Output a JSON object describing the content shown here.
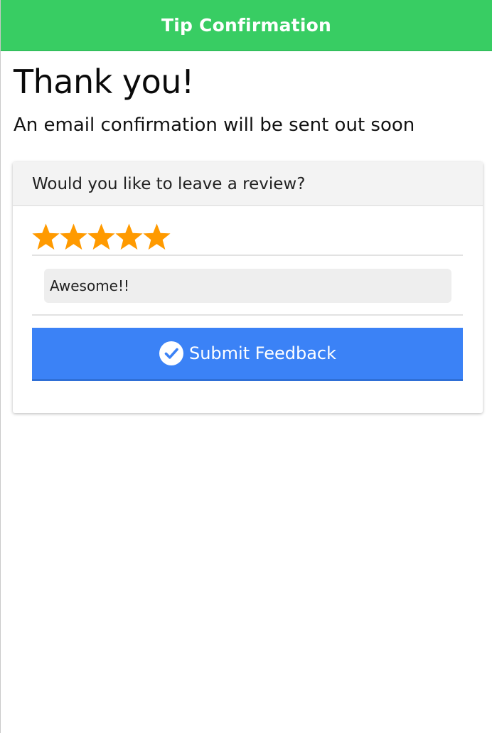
{
  "header": {
    "title": "Tip Confirmation",
    "background_color": "#38cd63"
  },
  "confirmation": {
    "title": "Thank you!",
    "message": "An email confirmation will be sent out soon"
  },
  "review": {
    "prompt": "Would you like to leave a review?",
    "rating": 5,
    "max_rating": 5,
    "star_color": "#ff9a00",
    "comment_value": "Awesome!!",
    "submit_label": "Submit Feedback",
    "submit_icon": "check-circle-icon",
    "submit_color": "#3b82f6"
  }
}
